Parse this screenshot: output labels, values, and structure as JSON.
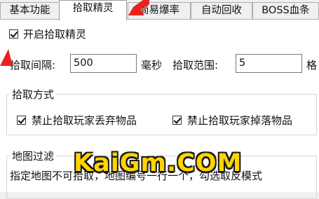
{
  "tabs": [
    {
      "label": "基本功能",
      "active": false
    },
    {
      "label": "拾取精灵",
      "active": true
    },
    {
      "label": "简易爆率",
      "active": false
    },
    {
      "label": "自动回收",
      "active": false
    },
    {
      "label": "BOSS血条",
      "active": false
    }
  ],
  "enable_pickup": {
    "label": "开启拾取精灵",
    "checked": true
  },
  "interval": {
    "label": "拾取间隔:",
    "value": "500",
    "unit": "毫秒"
  },
  "range": {
    "label": "拾取范围:",
    "value": "5",
    "unit": "格"
  },
  "pickup_mode": {
    "title": "拾取方式",
    "options": [
      {
        "label": "禁止拾取玩家丢弃物品",
        "checked": true
      },
      {
        "label": "禁止拾取玩家掉落物品",
        "checked": true
      }
    ]
  },
  "map_filter": {
    "title": "地图过滤",
    "description": "指定地图不可拾取，地图编号一行一个，勾选取反模式"
  },
  "watermark": "KaiGm.COM",
  "colors": {
    "arrow": "#e8231f",
    "watermark": "#ffd400"
  }
}
